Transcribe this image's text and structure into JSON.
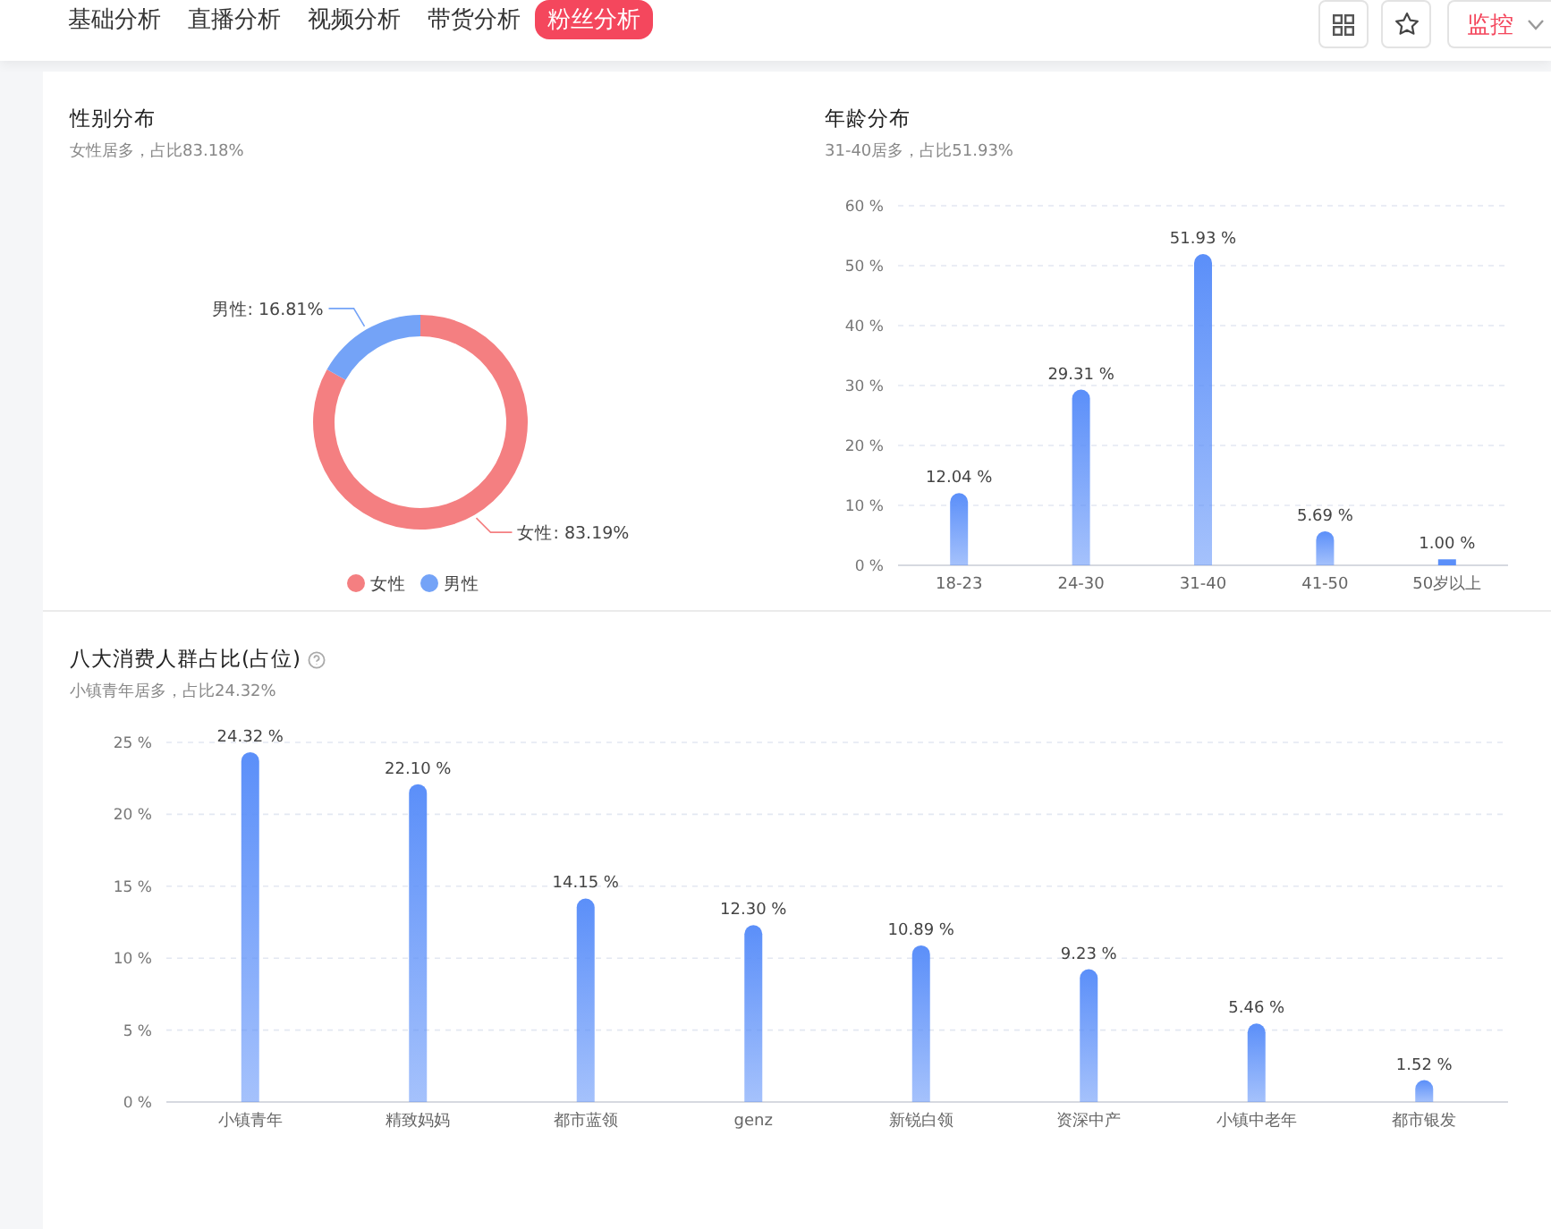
{
  "nav": {
    "tabs": [
      {
        "label": "基础分析",
        "selected": false
      },
      {
        "label": "直播分析",
        "selected": false
      },
      {
        "label": "视频分析",
        "selected": false
      },
      {
        "label": "带货分析",
        "selected": false
      },
      {
        "label": "粉丝分析",
        "selected": true
      }
    ],
    "monitor_button": {
      "label": "监控"
    }
  },
  "gender": {
    "title": "性别分布",
    "subtitle": "女性居多，占比83.18%",
    "chart_data": {
      "type": "donut",
      "categories": [
        "女性",
        "男性"
      ],
      "series": [
        {
          "values": [
            83.19,
            16.81
          ]
        }
      ],
      "colors": [
        "#f47f81",
        "#74a3f7"
      ],
      "legend": "bottom",
      "value_labels": [
        "女性: 83.19%",
        "男性: 16.81%"
      ]
    }
  },
  "age": {
    "title": "年龄分布",
    "subtitle": "31-40居多，占比51.93%",
    "chart_data": {
      "type": "bar",
      "categories": [
        "18-23",
        "24-30",
        "31-40",
        "41-50",
        "50岁以上"
      ],
      "series": [
        {
          "color": "#5b8ff9",
          "values": [
            12.04,
            29.31,
            51.93,
            5.69,
            1.0
          ]
        }
      ],
      "ylim": [
        0,
        60
      ],
      "grid": true,
      "yticks": [
        {
          "value": 0,
          "label": "0 %"
        },
        {
          "value": 10,
          "label": "10 %"
        },
        {
          "value": 20,
          "label": "20 %"
        },
        {
          "value": 30,
          "label": "30 %"
        },
        {
          "value": 40,
          "label": "40 %"
        },
        {
          "value": 50,
          "label": "50 %"
        },
        {
          "value": 60,
          "label": "60 %"
        }
      ],
      "value_labels": [
        "12.04 %",
        "29.31 %",
        "51.93 %",
        "5.69 %",
        "1.00 %"
      ]
    }
  },
  "consumers": {
    "title": "八大消费人群占比(占位)",
    "help_icon": true,
    "subtitle": "小镇青年居多，占比24.32%",
    "chart_data": {
      "type": "bar",
      "categories": [
        "小镇青年",
        "精致妈妈",
        "都市蓝领",
        "genz",
        "新锐白领",
        "资深中产",
        "小镇中老年",
        "都市银发"
      ],
      "series": [
        {
          "color": "#5b8ff9",
          "values": [
            24.32,
            22.1,
            14.15,
            12.3,
            10.89,
            9.23,
            5.46,
            1.52
          ]
        }
      ],
      "ylim": [
        0,
        25
      ],
      "grid": true,
      "yticks": [
        {
          "value": 0,
          "label": "0 %"
        },
        {
          "value": 5,
          "label": "5 %"
        },
        {
          "value": 10,
          "label": "10 %"
        },
        {
          "value": 15,
          "label": "15 %"
        },
        {
          "value": 20,
          "label": "20 %"
        },
        {
          "value": 25,
          "label": "25 %"
        }
      ],
      "value_labels": [
        "24.32 %",
        "22.10 %",
        "14.15 %",
        "12.30 %",
        "10.89 %",
        "9.23 %",
        "5.46 %",
        "1.52 %"
      ]
    }
  }
}
